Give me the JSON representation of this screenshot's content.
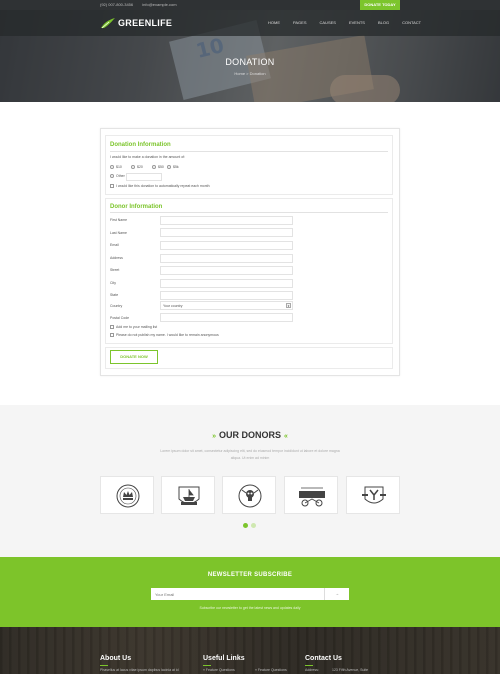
{
  "colors": {
    "accent": "#7cc52c",
    "dark": "#2f3234"
  },
  "topbar": {
    "phone": "(92) 007-800-3456",
    "email": "info@example.com",
    "donate_label": "DONATE TODAY"
  },
  "brand": {
    "name": "GREENLIFE"
  },
  "nav": {
    "items": [
      "HOME",
      "PAGES",
      "CAUSES",
      "EVENTS",
      "BLOG",
      "CONTACT"
    ]
  },
  "hero": {
    "title": "DONATION",
    "breadcrumb": "Home > Donation"
  },
  "donation": {
    "title": "Donation Information",
    "prompt": "I would like to make a donation in the amount of:",
    "amounts": [
      "$10",
      "$20",
      "$50",
      "$5k"
    ],
    "other_label": "Other",
    "recurring_label": "I would like this donation to automatically repeat each month"
  },
  "donor": {
    "title": "Donor Information",
    "fields": [
      "First Name",
      "Last Name",
      "Email",
      "Address",
      "Street",
      "City",
      "State",
      "Country",
      "Postal Code"
    ],
    "country_value": "Your country",
    "checkbox1": "Add me to your mailing list",
    "checkbox2": "Please do not publish my name. I would like to remain anonymous",
    "submit_label": "DONATE NOW"
  },
  "donors_section": {
    "title": "OUR DONORS",
    "description": "Lorem ipsum dolor sit amet, consectetur adipiscing elit, sed do eiusmod tempor incididunt ut labore et dolore magna aliqua. Ut enim ad minim",
    "logos": [
      "crown-badge-logo",
      "ship-shield-logo",
      "skull-badge-logo",
      "motorbike-logo",
      "letter-y-badge-logo"
    ],
    "page_index": 1,
    "page_count": 2
  },
  "newsletter": {
    "title": "NEWSLETTER SUBSCRIBE",
    "placeholder": "Your Email",
    "button_label": "→",
    "note": "Subscribe our newsletter to get the latest news and updates daily"
  },
  "footer": {
    "about_title": "About Us",
    "about_text": "Phasellus at lacus vitae ipsum dapibus lacinia at id",
    "links_title": "Useful Links",
    "link_a": "» Feature Questions",
    "link_b": "» Feature Questions",
    "contact_title": "Contact Us",
    "contact_label": "Address:",
    "contact_value": "123 Fifth Avenue, Suite"
  }
}
